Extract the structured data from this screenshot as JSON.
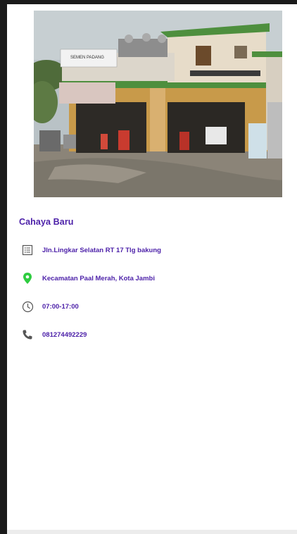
{
  "place": {
    "name": "Cahaya Baru",
    "address": "Jln.Lingkar Selatan RT 17 Tlg bakung",
    "district": "Kecamatan Paal Merah, Kota Jambi",
    "hours": "07:00-17:00",
    "phone": "081274492229"
  },
  "photo": {
    "sign_text": "SEMEN PADANG"
  },
  "icons": {
    "address": "list-icon",
    "district": "location-pin-icon",
    "hours": "clock-icon",
    "phone": "phone-icon"
  },
  "colors": {
    "accent_text": "#4b1fa8",
    "pin": "#2ecc40",
    "icon_gray": "#555555"
  }
}
